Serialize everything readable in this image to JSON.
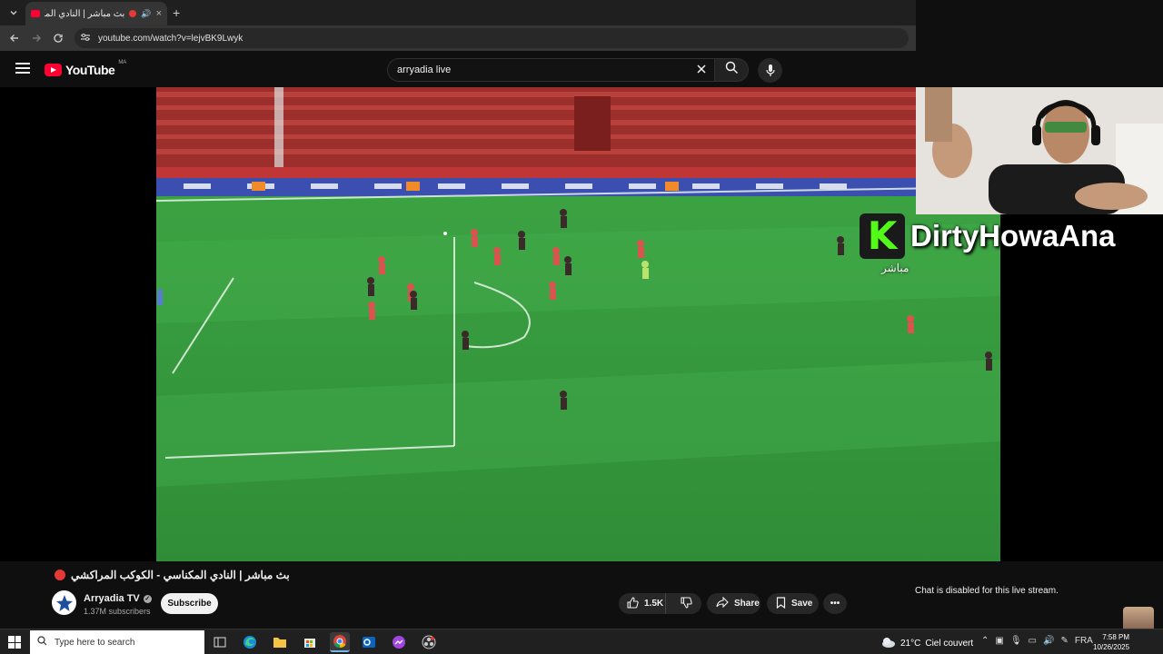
{
  "browser": {
    "tab_title": "بث مباشر | النادي المكناسي",
    "new_tab_symbol": "+",
    "tab_close": "×",
    "url": "youtube.com/watch?v=lejvBK9Lwyk"
  },
  "youtube": {
    "logo_text": "YouTube",
    "country_code": "MA",
    "search_query": "arryadia live"
  },
  "overlay": {
    "streamer_name": "DirtyHowaAna",
    "kick_logo": "K",
    "live_label": "مباشر"
  },
  "video": {
    "title": "بث مباشر | النادي المكناسي - الكوكب المراكشي",
    "channel": "Arryadia TV",
    "subscribers": "1.37M subscribers",
    "subscribe_label": "Subscribe",
    "likes": "1.5K",
    "share_label": "Share",
    "save_label": "Save",
    "more_label": "•••",
    "chat_notice": "Chat is disabled for this live stream."
  },
  "taskbar": {
    "search_placeholder": "Type here to search",
    "temperature": "21°C",
    "weather": "Ciel couvert",
    "language": "FRA",
    "time": "7:58 PM",
    "date": "10/26/2025"
  },
  "colors": {
    "yt_red": "#ff0033",
    "kick_green": "#53fc18",
    "pitch_green": "#3aa043",
    "home_kit": "#d9534f",
    "away_kit": "#3b2a2a"
  },
  "icons": [
    "chevron-down-icon",
    "back-icon",
    "forward-icon",
    "reload-icon",
    "site-info-icon",
    "menu-icon",
    "search-icon",
    "close-icon",
    "mic-icon",
    "like-icon",
    "dislike-icon",
    "share-icon",
    "save-icon",
    "more-icon",
    "verified-icon",
    "windows-icon",
    "weather-icon"
  ]
}
